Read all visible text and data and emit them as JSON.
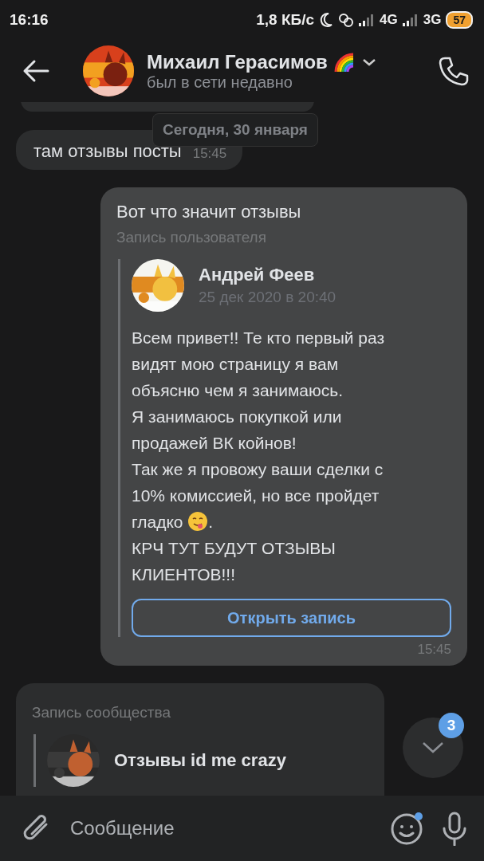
{
  "status_bar": {
    "time": "16:16",
    "speed": "1,8 КБ/с",
    "network_1": "4G",
    "network_2": "3G",
    "battery": "57"
  },
  "header": {
    "name": "Михаил Герасимов",
    "status": "был в сети недавно"
  },
  "date_chip": "Сегодня, 30 января",
  "messages": [
    {
      "kind": "text",
      "outgoing": false,
      "text": "там отзывы посты",
      "time": "15:45"
    },
    {
      "kind": "post",
      "outgoing": true,
      "text": "Вот что значит отзывы",
      "label": "Запись пользователя",
      "author": "Андрей Феев",
      "date": "25 дек 2020 в 20:40",
      "paragraphs": [
        {
          "text": "Всем привет!! Те кто первый раз видят мою страницу я вам объясню чем я занимаюсь."
        },
        {
          "text": "Я занимаюсь покупкой или продажей ВК койнов!"
        },
        {
          "text": "Так же я провожу ваши сделки с 10% комиссией, но все пройдет"
        },
        {
          "text": "гладко",
          "emoji": true,
          "tail": "."
        },
        {
          "text": "КРЧ ТУТ БУДУТ ОТЗЫВЫ КЛИЕНТОВ!!!"
        }
      ],
      "button": "Открыть запись",
      "time": "15:45"
    },
    {
      "kind": "post",
      "outgoing": false,
      "label": "Запись сообщества",
      "author": "Отзывы id me crazy"
    }
  ],
  "scroll_button": {
    "badge": "3"
  },
  "composer": {
    "placeholder": "Сообщение",
    "emoji_dot": true
  }
}
